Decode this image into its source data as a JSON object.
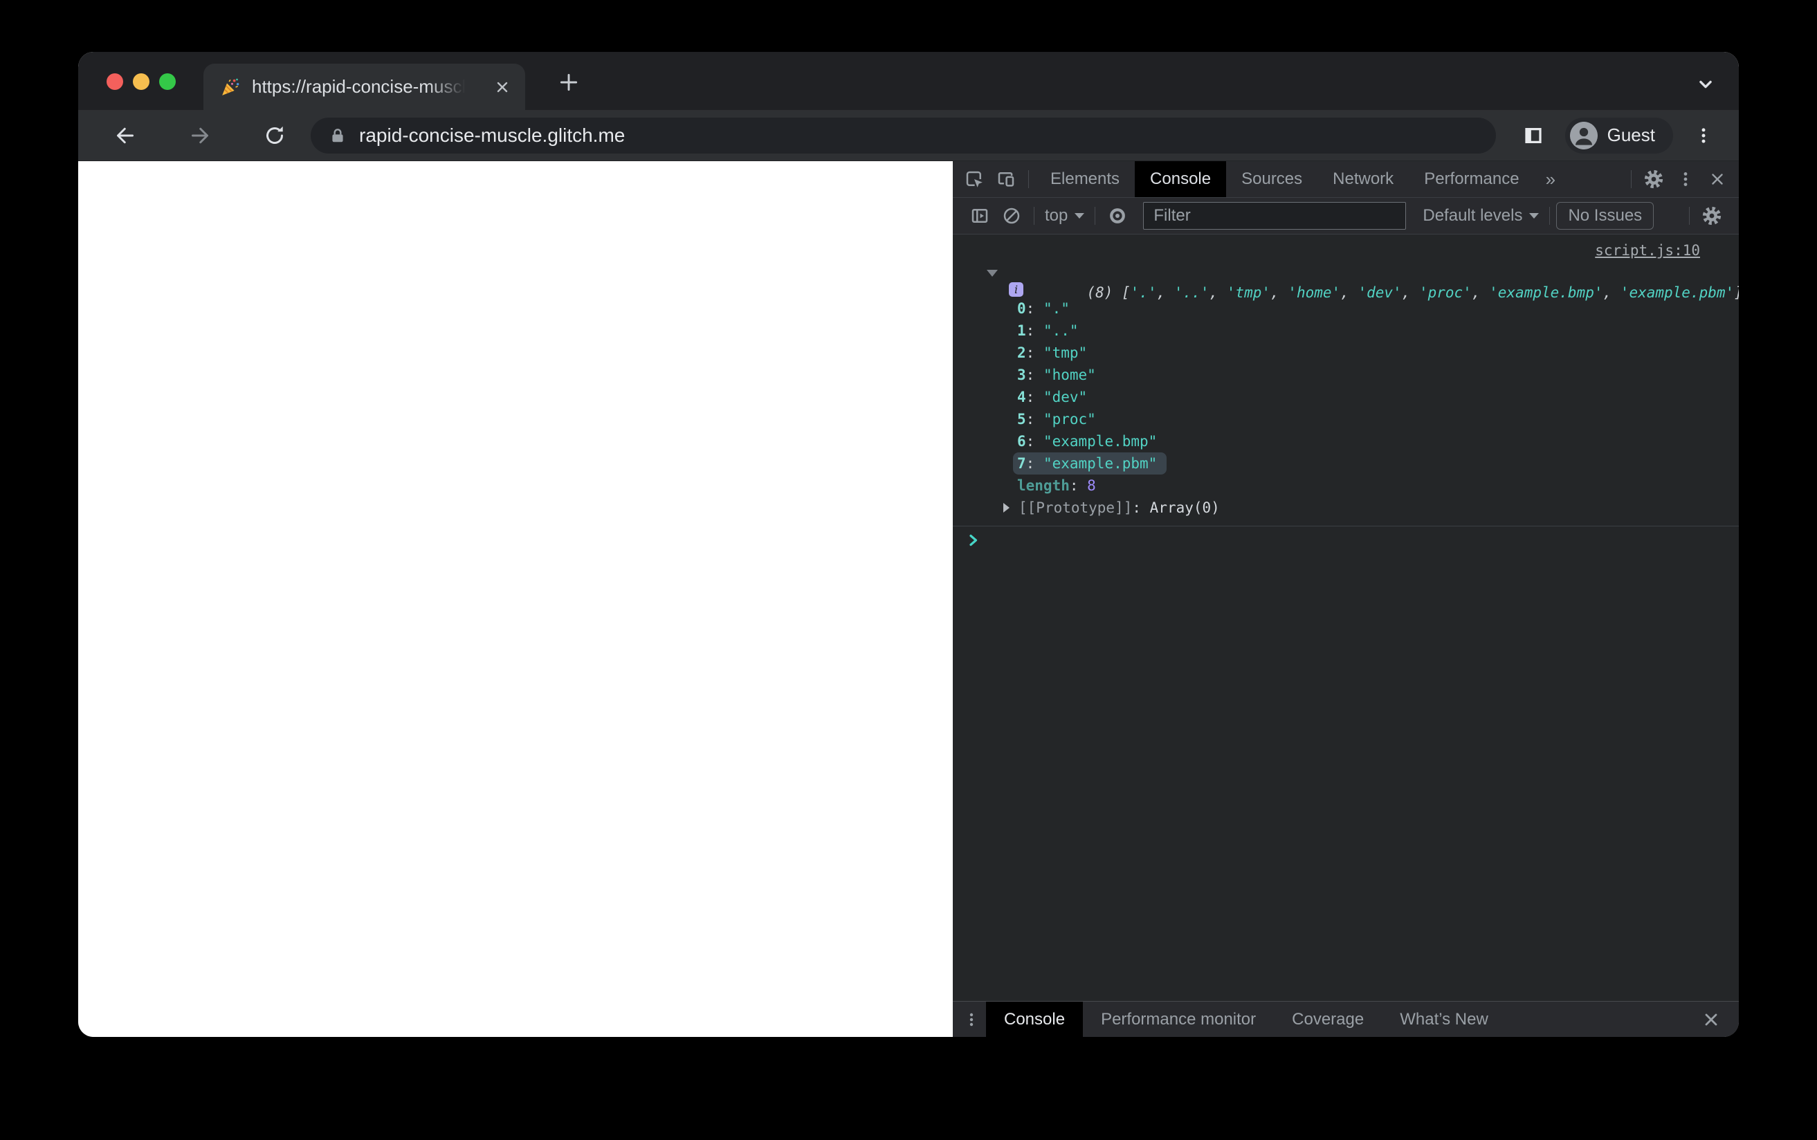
{
  "colors": {
    "accent_teal": "#52D3C4",
    "index_teal": "#85E0D6",
    "dim_teal": "#4E9C96",
    "number_violet": "#9E8CFC",
    "info_badge_lavender": "#AEA7F1",
    "highlight_row": "#3A444C",
    "traffic_red": "#F4605C",
    "traffic_yellow": "#F6BE4F",
    "traffic_green": "#34C848",
    "devtools_bg": "#242628",
    "chrome_bg": "#2E3033"
  },
  "icons": {
    "tab_favicon": "party-popper",
    "address_security": "lock",
    "profile": "person-avatar",
    "clear_console": "slashed-circle",
    "live_expression": "eye",
    "settings": "gear"
  },
  "browser": {
    "tab": {
      "title": "https://rapid-concise-muscle.g"
    },
    "url": "rapid-concise-muscle.glitch.me",
    "profile_label": "Guest"
  },
  "devtools": {
    "panel_tabs": [
      "Elements",
      "Console",
      "Sources",
      "Network",
      "Performance"
    ],
    "active_panel_tab": "Console",
    "more_tabs_label": "»",
    "toolbar": {
      "context_label": "top",
      "filter_placeholder": "Filter",
      "levels_label": "Default levels",
      "issues_label": "No Issues"
    },
    "console": {
      "source_link": "script.js:10",
      "info_badge": "i",
      "colon": ": ",
      "preview": [
        {
          "t": "meta",
          "v": "(8) "
        },
        {
          "t": "punc",
          "v": "["
        },
        {
          "t": "str",
          "v": "'.'"
        },
        {
          "t": "punc",
          "v": ", "
        },
        {
          "t": "str",
          "v": "'..'"
        },
        {
          "t": "punc",
          "v": ", "
        },
        {
          "t": "str",
          "v": "'tmp'"
        },
        {
          "t": "punc",
          "v": ", "
        },
        {
          "t": "str",
          "v": "'home'"
        },
        {
          "t": "punc",
          "v": ", "
        },
        {
          "t": "str",
          "v": "'dev'"
        },
        {
          "t": "punc",
          "v": ", "
        },
        {
          "t": "str",
          "v": "'proc'"
        },
        {
          "t": "punc",
          "v": ", "
        },
        {
          "t": "str",
          "v": "'example.bmp'"
        },
        {
          "t": "punc",
          "v": ", "
        },
        {
          "t": "str",
          "v": "'example.pbm'"
        },
        {
          "t": "punc",
          "v": "]"
        }
      ],
      "entries": [
        {
          "key": "0",
          "value": "\".\""
        },
        {
          "key": "1",
          "value": "\"..\""
        },
        {
          "key": "2",
          "value": "\"tmp\""
        },
        {
          "key": "3",
          "value": "\"home\""
        },
        {
          "key": "4",
          "value": "\"dev\""
        },
        {
          "key": "5",
          "value": "\"proc\""
        },
        {
          "key": "6",
          "value": "\"example.bmp\""
        },
        {
          "key": "7",
          "value": "\"example.pbm\""
        }
      ],
      "highlighted_entry_key": "7",
      "length_row": {
        "key": "length",
        "value": "8"
      },
      "prototype_row": {
        "key": "[[Prototype]]",
        "value": "Array(0)"
      }
    },
    "drawer_tabs": [
      "Console",
      "Performance monitor",
      "Coverage",
      "What’s New"
    ],
    "active_drawer_tab": "Console"
  }
}
